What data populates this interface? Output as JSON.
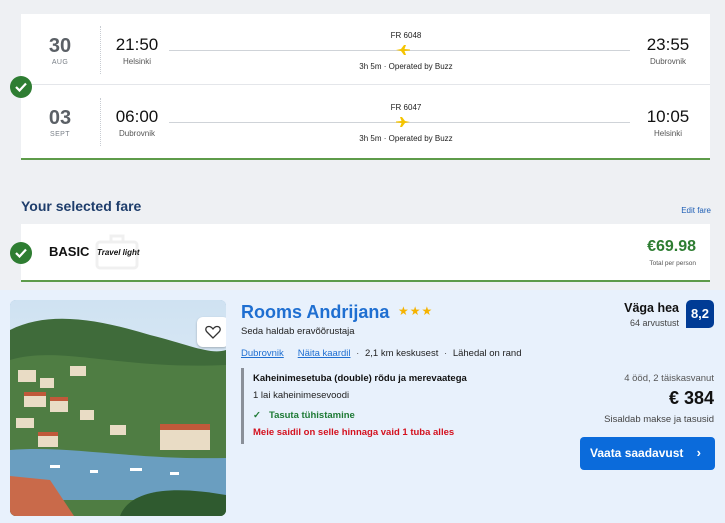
{
  "flights": {
    "outbound": {
      "day": "30",
      "month": "AUG",
      "dep_time": "21:50",
      "dep_city": "Helsinki",
      "flight_no": "FR 6048",
      "duration": "3h 5m · Operated by Buzz",
      "arr_time": "23:55",
      "arr_city": "Dubrovnik"
    },
    "return": {
      "day": "03",
      "month": "SEPT",
      "dep_time": "06:00",
      "dep_city": "Dubrovnik",
      "flight_no": "FR 6047",
      "duration": "3h 5m · Operated by Buzz",
      "arr_time": "10:05",
      "arr_city": "Helsinki"
    },
    "plane_icon": "plane-icon",
    "accent_color": "#f5c400"
  },
  "fare": {
    "heading": "Your selected fare",
    "edit_link": "Edit fare",
    "name": "BASIC",
    "subtitle": "Travel light",
    "price": "€69.98",
    "price_note": "Total per person",
    "status_color": "#2e7d32"
  },
  "hotel": {
    "name": "Rooms Andrijana",
    "stars": "★★★",
    "operator": "Seda haldab eravõõrustaja",
    "location_link": "Dubrovnik",
    "map_link": "Näita kaardil",
    "distance": "2,1 km keskusest",
    "beach": "Lähedal on rand",
    "room_name": "Kaheinimesetuba (double) rõdu ja merevaatega",
    "bed": "1 lai kaheinimesevoodi",
    "cancellation": "Tasuta tühistamine",
    "availability": "Meie saidil on selle hinnaga vaid 1 tuba alles",
    "rating_word": "Väga hea",
    "review_count": "64 arvustust",
    "score": "8,2",
    "stay": "4 ööd, 2 täiskasvanut",
    "price": "€ 384",
    "price_note": "Sisaldab makse ja tasusid",
    "cta": "Vaata saadavust",
    "brand_color": "#0b6bdb",
    "score_color": "#003b95"
  }
}
